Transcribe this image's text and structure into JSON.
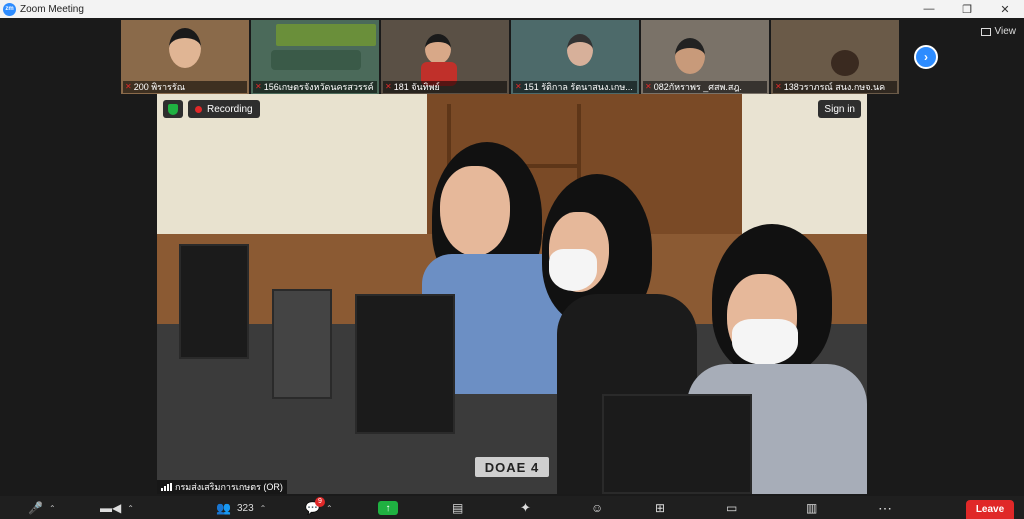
{
  "window": {
    "logo": "zm",
    "title": "Zoom Meeting",
    "minimize": "—",
    "restore": "❐",
    "close": "✕"
  },
  "view_label": "View",
  "participants": [
    {
      "name": "200 พิรารรัณ",
      "bg": "#8a6a4a"
    },
    {
      "name": "156เกษตรจังหวัดนครสวรรค์",
      "bg": "#4b6a5a"
    },
    {
      "name": "181 จันทิพย์",
      "bg": "#5a5045"
    },
    {
      "name": "151 รัติกาล รัตนาสนง.เกษ...",
      "bg": "#4d6a6a"
    },
    {
      "name": "082กัหราพร _ศสพ.สฎ.",
      "bg": "#7a7268"
    },
    {
      "name": "138วราภรณ์ สนง.กษจ.นค",
      "bg": "#6a5a48"
    }
  ],
  "main_video": {
    "recording_label": "Recording",
    "signin_label": "Sign in",
    "name_plate": "DOAE 4",
    "speaker_name": "กรมส่งเสริมการเกษตร (OR)"
  },
  "toolbar": {
    "participant_count": "323",
    "chat_badge": "9",
    "leave_label": "Leave"
  },
  "colors": {
    "zoom_blue": "#2d8cff",
    "recording_red": "#e02828",
    "share_green": "#1fb141",
    "toolbar_bg": "#1f1f1f"
  }
}
